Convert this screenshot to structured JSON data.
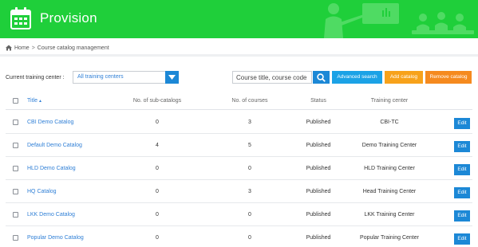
{
  "header": {
    "app_title": "Provision",
    "icon": "calendar-icon",
    "color": "#1fcf3a"
  },
  "breadcrumb": {
    "home": "Home",
    "separator": ">",
    "current": "Course catalog management"
  },
  "filters": {
    "center_label": "Current training center :",
    "center_value": "All training centers",
    "search_placeholder": "Course title, course code",
    "advanced_search": "Advanced search",
    "add_catalog": "Add catalog",
    "remove_catalog": "Remove catalog"
  },
  "table": {
    "columns": {
      "title": "Title",
      "sub_catalogs": "No. of sub-catalogs",
      "courses": "No. of courses",
      "status": "Status",
      "center": "Training center"
    },
    "edit_label": "Edit",
    "rows": [
      {
        "title": "CBI Demo Catalog",
        "sub": "0",
        "courses": "3",
        "status": "Published",
        "center": "CBI-TC"
      },
      {
        "title": "Default Demo Catalog",
        "sub": "4",
        "courses": "5",
        "status": "Published",
        "center": "Demo Training Center"
      },
      {
        "title": "HLD Demo Catalog",
        "sub": "0",
        "courses": "0",
        "status": "Published",
        "center": "HLD Training Center"
      },
      {
        "title": "HQ Catalog",
        "sub": "0",
        "courses": "3",
        "status": "Published",
        "center": "Head Training Center"
      },
      {
        "title": "LKK Demo Catalog",
        "sub": "0",
        "courses": "0",
        "status": "Published",
        "center": "LKK Training Center"
      },
      {
        "title": "Popular Demo Catalog",
        "sub": "0",
        "courses": "0",
        "status": "Published",
        "center": "Popular Training Center"
      }
    ]
  }
}
